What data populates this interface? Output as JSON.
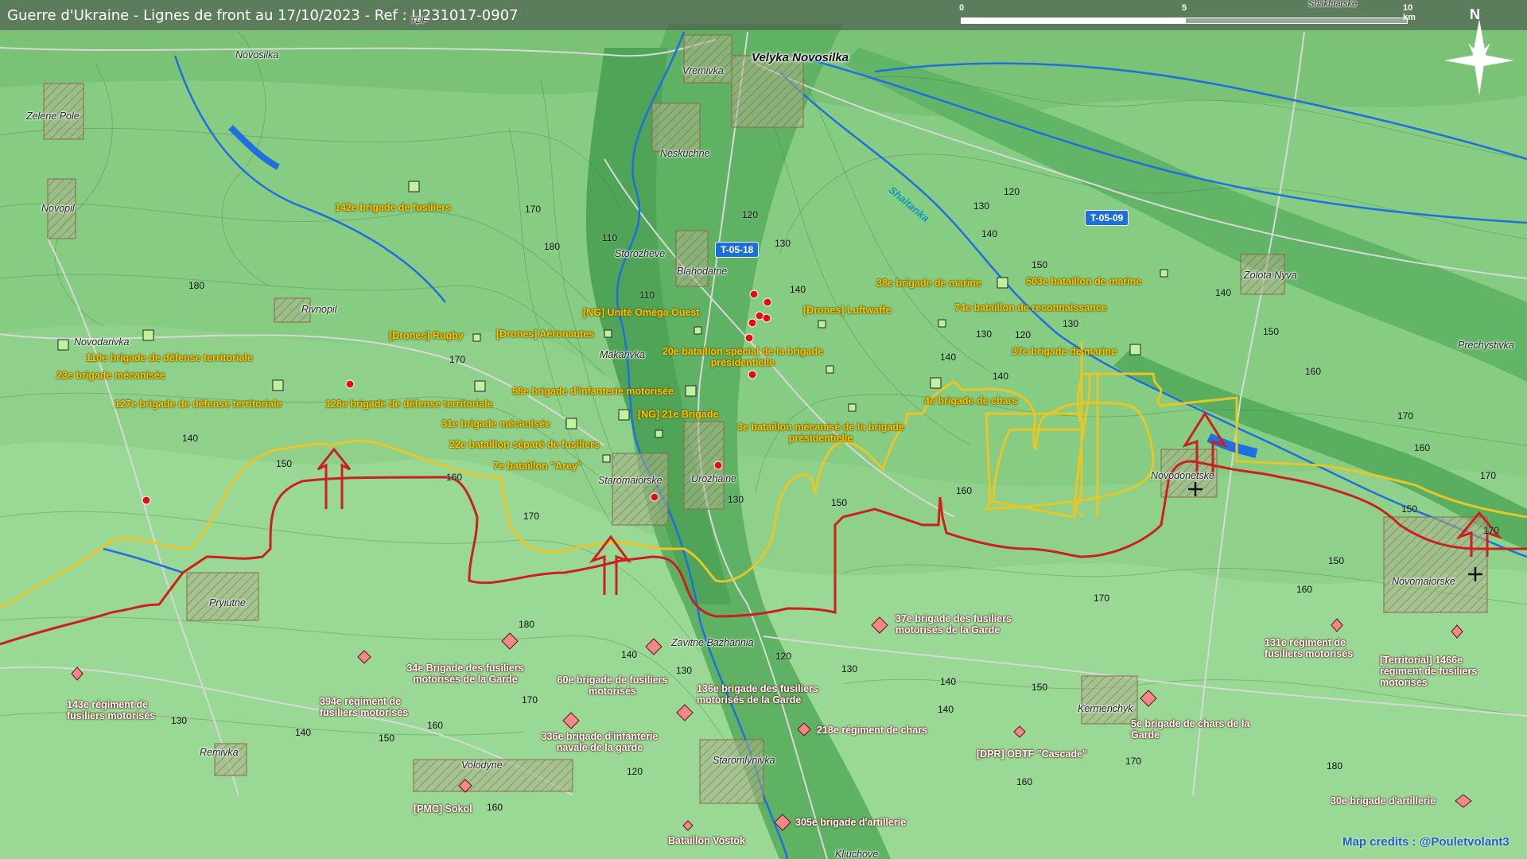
{
  "title": "Guerre d'Ukraine - Lignes de front au 17/10/2023 - Ref : U231017-0907",
  "scale": {
    "labels": [
      "0",
      "5",
      "10 km"
    ]
  },
  "north_label": "N",
  "credits": "Map credits : @Pouletvolant3",
  "top_cut_labels": [
    "TDF",
    "Shakhtarske"
  ],
  "colors": {
    "ukraine_line": "#e8c626",
    "russia_line": "#cc1f1f",
    "ukraine_unit": "#bff29a",
    "russia_unit": "#f08a8a",
    "river": "#1f6fe0",
    "title_bar": "#595959"
  },
  "places": {
    "velyka_novosilka": "Velyka Novosilka",
    "novosilka": "Novosilka",
    "zelene_pole": "Zelene Pole",
    "vremivka": "Vremivka",
    "neskuchne": "Neskuchne",
    "novopil": "Novopil",
    "storozheve": "Storozheve",
    "blahodatne": "Blahodatne",
    "rivnopil": "Rivnopil",
    "novodarivka": "Novodarivka",
    "makarivka": "Makarivka",
    "staromaiorske": "Staromaiorske",
    "urozhaine": "Urozhaine",
    "zolota_nyva": "Zolota Nyva",
    "prechystivka": "Prechystivka",
    "novodonetske": "Novodonetske",
    "novomaiorske": "Novomaiorske",
    "pryiutne": "Pryiutne",
    "zavitne_bazhannia": "Zavitne Bazhannia",
    "kermenchyk": "Kermenchyk",
    "remivka": "Remivka",
    "volodyne": "Volodyne",
    "staromlynivka": "Staromlynivka",
    "kliuchove": "Kliuchove"
  },
  "river_label": "Shaitanka",
  "roads": [
    "T-05-18",
    "T-05-09"
  ],
  "ukraine_units": [
    "142e brigade de fusiliers",
    "110e brigade de défense territoriale",
    "23e brigade mécanisée",
    "127e brigade de défense territoriale",
    "128e brigade de défense territoriale",
    "[Drones] Rugby",
    "[Drones] Aéronautes",
    "[NG] Unité Oméga Ouest",
    "20e bataillon spécial de la brigade présidentielle",
    "[Drones] Luftwaffe",
    "38e brigade de marine",
    "503e bataillon de marine",
    "74e bataillon de reconnaissance",
    "37e brigade de marine",
    "58e brigade d'infanterie motorisée",
    "[NG] 21e Brigade",
    "31e brigade mécanisée",
    "22e bataillon séparé de fusiliers",
    "7e bataillon \"Arey\"",
    "3e bataillon mécanisé de la brigade présidentielle",
    "4e brigade de chars"
  ],
  "russia_units": [
    "143e régiment de fusiliers motorisés",
    "394e régiment de fusiliers motorisés",
    "34e Brigade des fusiliers motorisés de la Garde",
    "60e brigade de fusiliers motorisés",
    "336e brigade d'infanterie navale de la garde",
    "136e brigade des fusiliers motorisés de la Garde",
    "218e régiment de chars",
    "37e brigade des fusiliers motorisés de la Garde",
    "[DPR] OBTF \"Cascade\"",
    "5e brigade de chars de la Garde",
    "131e régiment de fusiliers motorisés",
    "[Territorial] 1466e régiment de fusiliers motorisés",
    "30e brigade d'artillerie",
    "305e brigade d'artillerie",
    "Bataillon Vostok",
    "[PMC] Sokol"
  ],
  "elevations": [
    "170",
    "180",
    "180",
    "120",
    "130",
    "110",
    "110",
    "140",
    "130",
    "120",
    "130",
    "140",
    "120",
    "130",
    "150",
    "140",
    "170",
    "140",
    "160",
    "170",
    "150",
    "140",
    "140",
    "150",
    "130",
    "160",
    "150",
    "170",
    "160",
    "150",
    "170",
    "160",
    "170",
    "160",
    "150",
    "180",
    "170",
    "140",
    "130",
    "120",
    "130",
    "140",
    "150",
    "170",
    "160",
    "130",
    "140",
    "150",
    "120",
    "160",
    "140",
    "170",
    "160",
    "180"
  ]
}
